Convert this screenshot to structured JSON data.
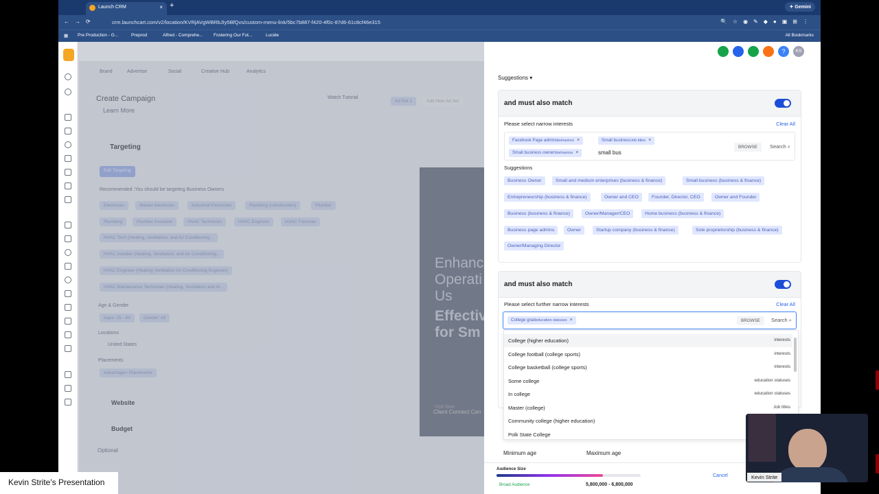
{
  "browser": {
    "tab_title": "Launch CRM",
    "url": "crm.launchcart.com/v2/location/KVRjAVgWBRbJIy5BfQvs/custom-menu-link/5bc7b887-f420-4f0c-87d6-61c8cf46e315",
    "gemini": "Gemini",
    "all_bookmarks": "All Bookmarks",
    "bookmarks": [
      "Pre Production - G...",
      "Preprod",
      "Alfred - Comprehe...",
      "Fostering Our Fut...",
      "Lucide"
    ]
  },
  "left": {
    "tabs": [
      "Brand",
      "Advertise",
      "Social",
      "Creative Hub",
      "Analytics"
    ],
    "create_campaign": "Create Campaign",
    "watch_tutorial": "Watch Tutorial",
    "learn_more": "Learn More",
    "ad_set": "Ad Set 1",
    "add_new": "Add New Ad Set",
    "targeting": "Targeting",
    "edit_targeting": "Edit Targeting",
    "recommended": "Recommended :You should be targeting Business Owners",
    "chips_row1": [
      "Electrician",
      "Master electrician",
      "Industrial Electrician",
      "Plumbing (construction)",
      "Plumber"
    ],
    "chips_row2": [
      "Plumbing",
      "Plumber Assistant",
      "HVAC Technician",
      "HVAC Engineer",
      "HVAC Foreman"
    ],
    "chips_long": [
      "HVAC Tech (Heating, Ventilation, and Air Conditioning...",
      "HVAC Installer (Heating, Ventilation, and Air Conditioning...",
      "HVAC Engineer (Heating Ventilation Air Conditioning Engineer)",
      "HVAC Maintenance Technician (Heating, Ventilation and Ai..."
    ],
    "age_gender": "Age & Gender",
    "age": "Ages: 25 - 64",
    "gender": "Gender: All",
    "locations": "Locations",
    "location": "United States",
    "placements": "Placements",
    "placement": "Advantage+ Placements",
    "website": "Website",
    "budget": "Budget",
    "optional": "Optional",
    "preview": {
      "l1": "Enhanc",
      "l2": "Operati",
      "l3": "Us",
      "l4": "Effectiv",
      "l5": "for Sm",
      "visit": "Visit Now",
      "brand": "Client Connect Cen"
    }
  },
  "panel": {
    "suggestions_toggle": "Suggestions",
    "sec1": {
      "title": "and must also match",
      "label": "Please select narrow interests",
      "clear": "Clear All",
      "tags": [
        {
          "name": "Facebook Page admins",
          "kind": "behaviors"
        },
        {
          "name": "Small business",
          "kind": "Job titles"
        },
        {
          "name": "Small business owners",
          "kind": "behaviors"
        }
      ],
      "input": "small bus",
      "browse": "BROWSE",
      "search": "Search",
      "suggestions_label": "Suggestions",
      "suggestions": [
        "Business Owner",
        "Small and medium enterprises (business & finance)",
        "Small business (business & finance)",
        "Entrepreneurship (business & finance)",
        "Owner and CEO",
        "Founder, Director, CEO",
        "Owner and Founder",
        "Business (business & finance)",
        "Owner/Manager/CEO",
        "Home business (business & finance)",
        "Business page admins",
        "Owner",
        "Startup company (business & finance)",
        "Sole proprietorship (business & finance)",
        "Owner/Managing Director"
      ]
    },
    "sec2": {
      "title": "and must also match",
      "label": "Please select further narrow interests",
      "clear": "Clear All",
      "tags": [
        {
          "name": "College grad",
          "kind": "education statuses"
        }
      ],
      "browse": "BROWSE",
      "search": "Search",
      "dropdown": [
        {
          "n": "College (higher education)",
          "k": "interests"
        },
        {
          "n": "College football (college sports)",
          "k": "interests"
        },
        {
          "n": "College basketball (college sports)",
          "k": "interests"
        },
        {
          "n": "Some college",
          "k": "education statuses"
        },
        {
          "n": "In college",
          "k": "education statuses"
        },
        {
          "n": "Master (college)",
          "k": "Job titles"
        },
        {
          "n": "Community college (higher education)",
          "k": ""
        },
        {
          "n": "Polk State College",
          "k": ""
        }
      ]
    },
    "min_age": "Minimum age",
    "max_age": "Maximum age",
    "audience": {
      "label": "Audience Size",
      "range": "Broad Audience",
      "value": "5,800,000 - 6,800,000",
      "fill": 0.74
    },
    "cancel": "Cancel",
    "avatar": "KS"
  },
  "presenter": {
    "caption": "Kevin Strite's Presentation",
    "name": "Kevin Strite"
  }
}
